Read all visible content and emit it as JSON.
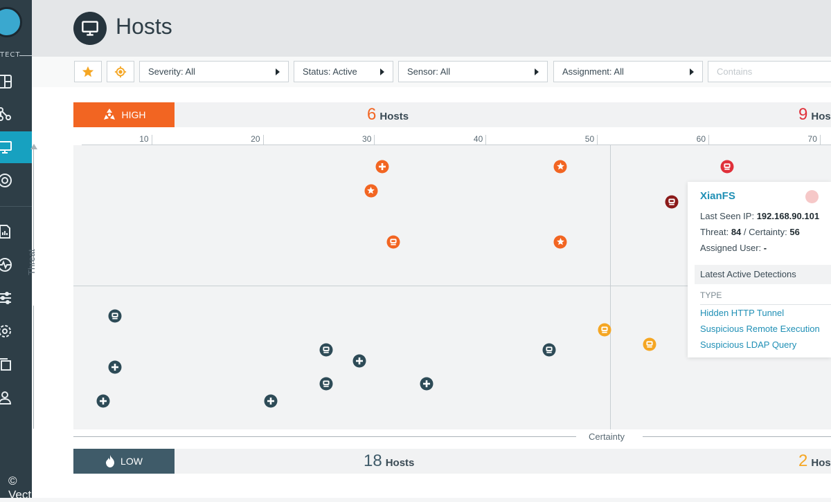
{
  "app": {
    "brand_fragment": "TECT",
    "watermark": "© Vectra"
  },
  "sidebar": {
    "items": [
      {
        "icon": "dashboard-icon",
        "active": false
      },
      {
        "icon": "campaigns-icon",
        "active": false
      },
      {
        "icon": "hosts-icon",
        "active": true
      },
      {
        "icon": "detections-icon",
        "active": false
      },
      {
        "icon": "reports-icon",
        "active": false
      },
      {
        "icon": "health-icon",
        "active": false
      },
      {
        "icon": "filters-icon",
        "active": false
      },
      {
        "icon": "settings-icon",
        "active": false
      },
      {
        "icon": "copy-icon",
        "active": false
      },
      {
        "icon": "user-icon",
        "active": false
      }
    ]
  },
  "header": {
    "title": "Hosts",
    "icon": "monitor-icon"
  },
  "filters": {
    "star_icon": "star-icon",
    "target_icon": "crosshair-icon",
    "severity": "Severity: All",
    "status": "Status: Active",
    "sensor": "Sensor: All",
    "assignment": "Assignment: All",
    "search_placeholder": "Contains"
  },
  "high_bar": {
    "label": "HIGH",
    "left_count": "6",
    "right_count": "9",
    "count_label": "Hosts",
    "right_count_label_visible": "Hos"
  },
  "low_bar": {
    "label": "LOW",
    "left_count": "18",
    "right_count": "2",
    "count_label": "Hosts",
    "right_count_label_visible": "Hos"
  },
  "chart_data": {
    "type": "scatter",
    "xlabel": "Certainty",
    "ylabel": "Threat",
    "x_ticks": [
      "10",
      "20",
      "30",
      "40",
      "50",
      "60",
      "70"
    ],
    "x_tick_values": [
      10,
      20,
      30,
      40,
      50,
      60,
      70
    ],
    "xlim": [
      3,
      71
    ],
    "points": [
      {
        "x": 30.7,
        "y": 92.5,
        "kind": "plus",
        "color": "#f26522"
      },
      {
        "x": 46.7,
        "y": 92.5,
        "kind": "star",
        "color": "#f26522"
      },
      {
        "x": 61.7,
        "y": 92.5,
        "kind": "host",
        "color": "#e0303a"
      },
      {
        "x": 29.7,
        "y": 84,
        "kind": "star",
        "color": "#f26522"
      },
      {
        "x": 56.7,
        "y": 80,
        "kind": "host",
        "color": "#8b1a1a"
      },
      {
        "x": 31.7,
        "y": 66,
        "kind": "host",
        "color": "#f26522"
      },
      {
        "x": 46.7,
        "y": 66,
        "kind": "star",
        "color": "#f26522"
      },
      {
        "x": 6.7,
        "y": 40,
        "kind": "host",
        "color": "#2e4b57"
      },
      {
        "x": 50.7,
        "y": 35,
        "kind": "host",
        "color": "#f5a623"
      },
      {
        "x": 54.7,
        "y": 30,
        "kind": "host",
        "color": "#f5a623"
      },
      {
        "x": 25.7,
        "y": 28,
        "kind": "host",
        "color": "#2e4b57"
      },
      {
        "x": 45.7,
        "y": 28,
        "kind": "host",
        "color": "#2e4b57"
      },
      {
        "x": 28.7,
        "y": 24,
        "kind": "plus",
        "color": "#2e4b57"
      },
      {
        "x": 6.7,
        "y": 22,
        "kind": "plus",
        "color": "#2e4b57"
      },
      {
        "x": 25.7,
        "y": 16,
        "kind": "host",
        "color": "#2e4b57"
      },
      {
        "x": 34.7,
        "y": 16,
        "kind": "plus",
        "color": "#2e4b57"
      },
      {
        "x": 5.7,
        "y": 10,
        "kind": "plus",
        "color": "#2e4b57"
      },
      {
        "x": 20.7,
        "y": 10,
        "kind": "plus",
        "color": "#2e4b57"
      }
    ]
  },
  "popup": {
    "title": "XianFS",
    "last_seen_label": "Last Seen IP:",
    "last_seen_value": "192.168.90.101",
    "threat_label": "Threat:",
    "threat_value": "84",
    "certainty_label": "/ Certainty:",
    "certainty_value": "56",
    "assigned_label": "Assigned User:",
    "assigned_value": "-",
    "section_title": "Latest Active Detections",
    "type_header": "TYPE",
    "detections": [
      "Hidden HTTP Tunnel",
      "Suspicious Remote Execution",
      "Suspicious LDAP Query"
    ]
  },
  "colors": {
    "high": "#f26522",
    "low": "#3f5b69",
    "high_right": "#e0303a",
    "low_right": "#f5a623",
    "accent": "#17a1c0"
  }
}
